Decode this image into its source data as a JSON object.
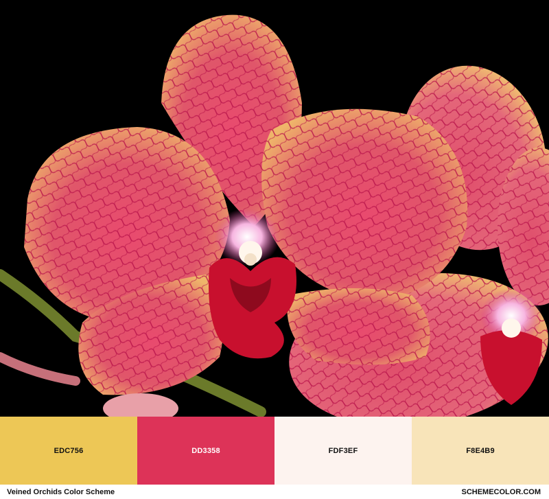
{
  "photo": {
    "subject": "veined-orchid-photo",
    "background_color": "#000000",
    "petal_color": "#DD3358",
    "vein_color": "#C2154A",
    "petal_base_color": "#EDC756",
    "lip_color": "#C8102E",
    "stem_color": "#6B7A2A"
  },
  "palette": {
    "swatches": [
      {
        "hex": "#EDC756",
        "label": "EDC756",
        "text_color": "#111111"
      },
      {
        "hex": "#DD3358",
        "label": "DD3358",
        "text_color": "#ffffff"
      },
      {
        "hex": "#FDF3EF",
        "label": "FDF3EF",
        "text_color": "#111111"
      },
      {
        "hex": "#F8E4B9",
        "label": "F8E4B9",
        "text_color": "#111111"
      }
    ]
  },
  "footer": {
    "title": "Veined Orchids Color Scheme",
    "site": "SCHEMECOLOR.COM"
  }
}
